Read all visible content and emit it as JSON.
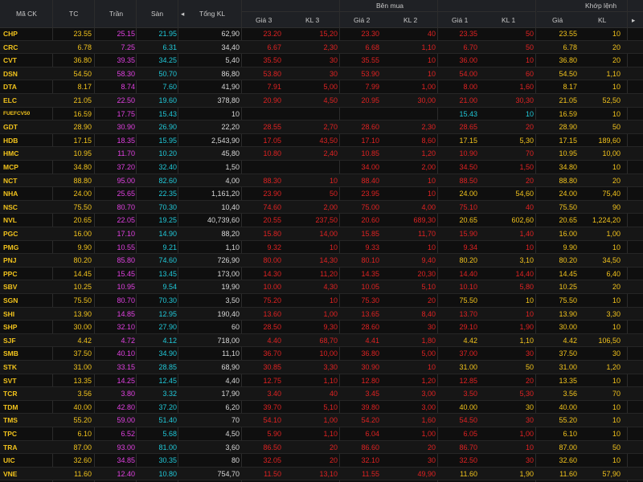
{
  "colors": {
    "reference": "#f2c31c",
    "ceiling": "#e040e0",
    "floor": "#20c8d8",
    "down": "#e02222",
    "up": "#1ec85a",
    "background": "#0f0f0f",
    "header": "#1f2125"
  },
  "header": {
    "symbol": "Mã CK",
    "ref": "TC",
    "ceiling": "Trần",
    "floor": "Sàn",
    "arrow_left": "◂",
    "arrow_right": "▸",
    "total_vol": "Tổng KL",
    "buy_side": "Bên mua",
    "buy_p3": "Giá 3",
    "buy_v3": "KL 3",
    "buy_p2": "Giá 2",
    "buy_v2": "KL 2",
    "buy_p1": "Giá 1",
    "buy_v1": "KL 1",
    "matched": "Khớp lệnh",
    "match_price": "Giá",
    "match_vol": "KL"
  },
  "rows": [
    {
      "sym": "CHP",
      "tc": "23.55",
      "tran": "25.15",
      "san": "21.95",
      "tkl": "62,90",
      "g3": "23.20",
      "k3": "15,20",
      "g2": "23.30",
      "k2": "40",
      "g1": "23.35",
      "k1": "50",
      "gm": "23.55",
      "km": "10",
      "g1c": "down",
      "k1c": "down",
      "gmc": "ref",
      "kmc": "ref"
    },
    {
      "sym": "CRC",
      "tc": "6.78",
      "tran": "7.25",
      "san": "6.31",
      "tkl": "34,40",
      "g3": "6.67",
      "k3": "2,30",
      "g2": "6.68",
      "k2": "1,10",
      "g1": "6.70",
      "k1": "50",
      "gm": "6.78",
      "km": "20",
      "g1c": "down",
      "k1c": "down",
      "gmc": "ref",
      "kmc": "ref"
    },
    {
      "sym": "CVT",
      "tc": "36.80",
      "tran": "39.35",
      "san": "34.25",
      "tkl": "5,40",
      "g3": "35.50",
      "k3": "30",
      "g2": "35.55",
      "k2": "10",
      "g1": "36.00",
      "k1": "10",
      "gm": "36.80",
      "km": "20",
      "g1c": "down",
      "k1c": "down",
      "gmc": "ref",
      "kmc": "ref"
    },
    {
      "sym": "DSN",
      "tc": "54.50",
      "tran": "58.30",
      "san": "50.70",
      "tkl": "86,80",
      "g3": "53.80",
      "k3": "30",
      "g2": "53.90",
      "k2": "10",
      "g1": "54.00",
      "k1": "60",
      "gm": "54.50",
      "km": "1,10",
      "g1c": "down",
      "k1c": "down",
      "gmc": "ref",
      "kmc": "ref"
    },
    {
      "sym": "DTA",
      "tc": "8.17",
      "tran": "8.74",
      "san": "7.60",
      "tkl": "41,90",
      "g3": "7.91",
      "k3": "5,00",
      "g2": "7.99",
      "k2": "1,00",
      "g1": "8.00",
      "k1": "1,60",
      "gm": "8.17",
      "km": "10",
      "g1c": "down",
      "k1c": "down",
      "gmc": "ref",
      "kmc": "ref"
    },
    {
      "sym": "ELC",
      "tc": "21.05",
      "tran": "22.50",
      "san": "19.60",
      "tkl": "378,80",
      "g3": "20.90",
      "k3": "4,50",
      "g2": "20.95",
      "k2": "30,00",
      "g1": "21.00",
      "k1": "30,30",
      "gm": "21.05",
      "km": "52,50",
      "g1c": "down",
      "k1c": "down",
      "gmc": "ref",
      "kmc": "ref"
    },
    {
      "sym": "FUEFCV50",
      "tc": "16.59",
      "tran": "17.75",
      "san": "15.43",
      "tkl": "10",
      "g3": "",
      "k3": "",
      "g2": "",
      "k2": "",
      "g1": "15.43",
      "k1": "10",
      "gm": "16.59",
      "km": "10",
      "g1c": "floor",
      "k1c": "floor",
      "gmc": "ref",
      "kmc": "ref"
    },
    {
      "sym": "GDT",
      "tc": "28.90",
      "tran": "30.90",
      "san": "26.90",
      "tkl": "22,20",
      "g3": "28.55",
      "k3": "2,70",
      "g2": "28.60",
      "k2": "2,30",
      "g1": "28.65",
      "k1": "20",
      "gm": "28.90",
      "km": "50",
      "g1c": "down",
      "k1c": "down",
      "gmc": "ref",
      "kmc": "ref"
    },
    {
      "sym": "HDB",
      "tc": "17.15",
      "tran": "18.35",
      "san": "15.95",
      "tkl": "2,543,90",
      "g3": "17.05",
      "k3": "43,50",
      "g2": "17.10",
      "k2": "8,60",
      "g1": "17.15",
      "k1": "5,30",
      "gm": "17.15",
      "km": "189,60",
      "g1c": "ref",
      "k1c": "ref",
      "gmc": "ref",
      "kmc": "ref"
    },
    {
      "sym": "HMC",
      "tc": "10.95",
      "tran": "11.70",
      "san": "10.20",
      "tkl": "45,80",
      "g3": "10.80",
      "k3": "2,40",
      "g2": "10.85",
      "k2": "1,20",
      "g1": "10.90",
      "k1": "70",
      "gm": "10.95",
      "km": "10,00",
      "g1c": "down",
      "k1c": "down",
      "gmc": "ref",
      "kmc": "ref"
    },
    {
      "sym": "MCP",
      "tc": "34.80",
      "tran": "37.20",
      "san": "32.40",
      "tkl": "1,50",
      "g3": "",
      "k3": "",
      "g2": "34.00",
      "k2": "2,00",
      "g1": "34.50",
      "k1": "1,50",
      "gm": "34.80",
      "km": "10",
      "g1c": "down",
      "k1c": "down",
      "gmc": "ref",
      "kmc": "ref"
    },
    {
      "sym": "NCT",
      "tc": "88.80",
      "tran": "95.00",
      "san": "82.60",
      "tkl": "4,00",
      "g3": "88.30",
      "k3": "10",
      "g2": "88.40",
      "k2": "10",
      "g1": "88.50",
      "k1": "20",
      "gm": "88.80",
      "km": "20",
      "g1c": "down",
      "k1c": "down",
      "gmc": "ref",
      "kmc": "ref"
    },
    {
      "sym": "NHA",
      "tc": "24.00",
      "tran": "25.65",
      "san": "22.35",
      "tkl": "1,161,20",
      "g3": "23.90",
      "k3": "50",
      "g2": "23.95",
      "k2": "10",
      "g1": "24.00",
      "k1": "54,60",
      "gm": "24.00",
      "km": "75,40",
      "g1c": "ref",
      "k1c": "ref",
      "gmc": "ref",
      "kmc": "ref"
    },
    {
      "sym": "NSC",
      "tc": "75.50",
      "tran": "80.70",
      "san": "70.30",
      "tkl": "10,40",
      "g3": "74.60",
      "k3": "2,00",
      "g2": "75.00",
      "k2": "4,00",
      "g1": "75.10",
      "k1": "40",
      "gm": "75.50",
      "km": "90",
      "g1c": "down",
      "k1c": "down",
      "gmc": "ref",
      "kmc": "ref"
    },
    {
      "sym": "NVL",
      "tc": "20.65",
      "tran": "22.05",
      "san": "19.25",
      "tkl": "40,739,60",
      "g3": "20.55",
      "k3": "237,50",
      "g2": "20.60",
      "k2": "689,30",
      "g1": "20.65",
      "k1": "602,60",
      "gm": "20.65",
      "km": "1,224,20",
      "g1c": "ref",
      "k1c": "ref",
      "gmc": "ref",
      "kmc": "ref"
    },
    {
      "sym": "PGC",
      "tc": "16.00",
      "tran": "17.10",
      "san": "14.90",
      "tkl": "88,20",
      "g3": "15.80",
      "k3": "14,00",
      "g2": "15.85",
      "k2": "11,70",
      "g1": "15.90",
      "k1": "1,40",
      "gm": "16.00",
      "km": "1,00",
      "g1c": "down",
      "k1c": "down",
      "gmc": "ref",
      "kmc": "ref"
    },
    {
      "sym": "PMG",
      "tc": "9.90",
      "tran": "10.55",
      "san": "9.21",
      "tkl": "1,10",
      "g3": "9.32",
      "k3": "10",
      "g2": "9.33",
      "k2": "10",
      "g1": "9.34",
      "k1": "10",
      "gm": "9.90",
      "km": "10",
      "g1c": "down",
      "k1c": "down",
      "gmc": "ref",
      "kmc": "ref"
    },
    {
      "sym": "PNJ",
      "tc": "80.20",
      "tran": "85.80",
      "san": "74.60",
      "tkl": "726,90",
      "g3": "80.00",
      "k3": "14,30",
      "g2": "80.10",
      "k2": "9,40",
      "g1": "80.20",
      "k1": "3,10",
      "gm": "80.20",
      "km": "34,50",
      "g1c": "ref",
      "k1c": "ref",
      "gmc": "ref",
      "kmc": "ref"
    },
    {
      "sym": "PPC",
      "tc": "14.45",
      "tran": "15.45",
      "san": "13.45",
      "tkl": "173,00",
      "g3": "14.30",
      "k3": "11,20",
      "g2": "14.35",
      "k2": "20,30",
      "g1": "14.40",
      "k1": "14,40",
      "gm": "14.45",
      "km": "6,40",
      "g1c": "down",
      "k1c": "down",
      "gmc": "ref",
      "kmc": "ref"
    },
    {
      "sym": "SBV",
      "tc": "10.25",
      "tran": "10.95",
      "san": "9.54",
      "tkl": "19,90",
      "g3": "10.00",
      "k3": "4,30",
      "g2": "10.05",
      "k2": "5,10",
      "g1": "10.10",
      "k1": "5,80",
      "gm": "10.25",
      "km": "20",
      "g1c": "down",
      "k1c": "down",
      "gmc": "ref",
      "kmc": "ref"
    },
    {
      "sym": "SGN",
      "tc": "75.50",
      "tran": "80.70",
      "san": "70.30",
      "tkl": "3,50",
      "g3": "75.20",
      "k3": "10",
      "g2": "75.30",
      "k2": "20",
      "g1": "75.50",
      "k1": "10",
      "gm": "75.50",
      "km": "10",
      "g1c": "ref",
      "k1c": "ref",
      "gmc": "ref",
      "kmc": "ref"
    },
    {
      "sym": "SHI",
      "tc": "13.90",
      "tran": "14.85",
      "san": "12.95",
      "tkl": "190,40",
      "g3": "13.60",
      "k3": "1,00",
      "g2": "13.65",
      "k2": "8,40",
      "g1": "13.70",
      "k1": "10",
      "gm": "13.90",
      "km": "3,30",
      "g1c": "down",
      "k1c": "down",
      "gmc": "ref",
      "kmc": "ref"
    },
    {
      "sym": "SHP",
      "tc": "30.00",
      "tran": "32.10",
      "san": "27.90",
      "tkl": "60",
      "g3": "28.50",
      "k3": "9,30",
      "g2": "28.60",
      "k2": "30",
      "g1": "29.10",
      "k1": "1,90",
      "gm": "30.00",
      "km": "10",
      "g1c": "down",
      "k1c": "down",
      "gmc": "ref",
      "kmc": "ref"
    },
    {
      "sym": "SJF",
      "tc": "4.42",
      "tran": "4.72",
      "san": "4.12",
      "tkl": "718,00",
      "g3": "4.40",
      "k3": "68,70",
      "g2": "4.41",
      "k2": "1,80",
      "g1": "4.42",
      "k1": "1,10",
      "gm": "4.42",
      "km": "106,50",
      "g1c": "ref",
      "k1c": "ref",
      "gmc": "ref",
      "kmc": "ref"
    },
    {
      "sym": "SMB",
      "tc": "37.50",
      "tran": "40.10",
      "san": "34.90",
      "tkl": "11,10",
      "g3": "36.70",
      "k3": "10,00",
      "g2": "36.80",
      "k2": "5,00",
      "g1": "37.00",
      "k1": "30",
      "gm": "37.50",
      "km": "30",
      "g1c": "down",
      "k1c": "down",
      "gmc": "ref",
      "kmc": "ref"
    },
    {
      "sym": "STK",
      "tc": "31.00",
      "tran": "33.15",
      "san": "28.85",
      "tkl": "68,90",
      "g3": "30.85",
      "k3": "3,30",
      "g2": "30.90",
      "k2": "10",
      "g1": "31.00",
      "k1": "50",
      "gm": "31.00",
      "km": "1,20",
      "g1c": "ref",
      "k1c": "ref",
      "gmc": "ref",
      "kmc": "ref"
    },
    {
      "sym": "SVT",
      "tc": "13.35",
      "tran": "14.25",
      "san": "12.45",
      "tkl": "4,40",
      "g3": "12.75",
      "k3": "1,10",
      "g2": "12.80",
      "k2": "1,20",
      "g1": "12.85",
      "k1": "20",
      "gm": "13.35",
      "km": "10",
      "g1c": "down",
      "k1c": "down",
      "gmc": "ref",
      "kmc": "ref"
    },
    {
      "sym": "TCR",
      "tc": "3.56",
      "tran": "3.80",
      "san": "3.32",
      "tkl": "17,90",
      "g3": "3.40",
      "k3": "40",
      "g2": "3.45",
      "k2": "3,00",
      "g1": "3.50",
      "k1": "5,30",
      "gm": "3.56",
      "km": "70",
      "g1c": "down",
      "k1c": "down",
      "gmc": "ref",
      "kmc": "ref"
    },
    {
      "sym": "TDM",
      "tc": "40.00",
      "tran": "42.80",
      "san": "37.20",
      "tkl": "6,20",
      "g3": "39.70",
      "k3": "5,10",
      "g2": "39.80",
      "k2": "3,00",
      "g1": "40.00",
      "k1": "30",
      "gm": "40.00",
      "km": "10",
      "g1c": "ref",
      "k1c": "ref",
      "gmc": "ref",
      "kmc": "ref"
    },
    {
      "sym": "TMS",
      "tc": "55.20",
      "tran": "59.00",
      "san": "51.40",
      "tkl": "70",
      "g3": "54.10",
      "k3": "1,00",
      "g2": "54.20",
      "k2": "1,60",
      "g1": "54.50",
      "k1": "30",
      "gm": "55.20",
      "km": "10",
      "g1c": "down",
      "k1c": "down",
      "gmc": "ref",
      "kmc": "ref"
    },
    {
      "sym": "TPC",
      "tc": "6.10",
      "tran": "6.52",
      "san": "5.68",
      "tkl": "4,50",
      "g3": "5.90",
      "k3": "1,10",
      "g2": "6.04",
      "k2": "1,00",
      "g1": "6.05",
      "k1": "1,00",
      "gm": "6.10",
      "km": "10",
      "g1c": "down",
      "k1c": "down",
      "gmc": "ref",
      "kmc": "ref"
    },
    {
      "sym": "TRA",
      "tc": "87.00",
      "tran": "93.00",
      "san": "81.00",
      "tkl": "3,60",
      "g3": "86.50",
      "k3": "20",
      "g2": "86.60",
      "k2": "20",
      "g1": "86.70",
      "k1": "10",
      "gm": "87.00",
      "km": "50",
      "g1c": "down",
      "k1c": "down",
      "gmc": "ref",
      "kmc": "ref"
    },
    {
      "sym": "UIC",
      "tc": "32.60",
      "tran": "34.85",
      "san": "30.35",
      "tkl": "80",
      "g3": "32.05",
      "k3": "20",
      "g2": "32.10",
      "k2": "30",
      "g1": "32.50",
      "k1": "30",
      "gm": "32.60",
      "km": "10",
      "g1c": "down",
      "k1c": "down",
      "gmc": "ref",
      "kmc": "ref"
    },
    {
      "sym": "VNE",
      "tc": "11.60",
      "tran": "12.40",
      "san": "10.80",
      "tkl": "754,70",
      "g3": "11.50",
      "k3": "13,10",
      "g2": "11.55",
      "k2": "49,90",
      "g1": "11.60",
      "k1": "1,90",
      "gm": "11.60",
      "km": "57,90",
      "g1c": "ref",
      "k1c": "ref",
      "gmc": "ref",
      "kmc": "ref"
    }
  ]
}
